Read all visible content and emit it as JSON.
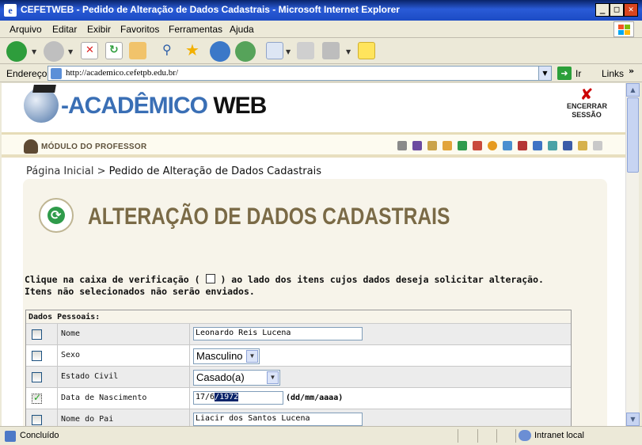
{
  "window": {
    "title": "CEFETWEB - Pedido de Alteração de Dados Cadastrais - Microsoft Internet Explorer",
    "min": "_",
    "max": "□",
    "close": "✕"
  },
  "menu": [
    "Arquivo",
    "Editar",
    "Exibir",
    "Favoritos",
    "Ferramentas",
    "Ajuda"
  ],
  "address": {
    "label": "Endereço",
    "url": "http://academico.cefetpb.edu.br/",
    "go_label": "Ir",
    "links_label": "Links"
  },
  "app": {
    "logo_part1": "-ACADÊMICO",
    "logo_part2": "WEB",
    "logout_line1": "ENCERRAR",
    "logout_line2": "SESSÃO",
    "module": "MÓDULO DO PROFESSOR"
  },
  "breadcrumb": {
    "home": "Página Inicial",
    "sep": " > ",
    "current": "Pedido de Alteração de Dados Cadastrais"
  },
  "panel": {
    "title": "ALTERAÇÃO DE DADOS CADASTRAIS",
    "instruction_a": "Clique na caixa de verificação (",
    "instruction_b": ") ao lado dos itens cujos dados deseja solicitar alteração.",
    "instruction_line2": "Itens não selecionados não serão enviados."
  },
  "form": {
    "section": "Dados Pessoais:",
    "rows": [
      {
        "label": "Nome",
        "value": "Leonardo Reis Lucena",
        "checked": false
      },
      {
        "label": "Sexo",
        "value": "Masculino",
        "checked": false
      },
      {
        "label": "Estado Civil",
        "value": "Casado(a)",
        "checked": false
      },
      {
        "label": "Data de Nascimento",
        "value_plain": "17/6",
        "value_selected": "/1972",
        "hint": "(dd/mm/aaaa)",
        "checked": true
      },
      {
        "label": "Nome do Pai",
        "value": "Liacir dos Santos Lucena",
        "checked": false
      }
    ]
  },
  "status": {
    "text": "Concluído",
    "zone": "Intranet local"
  }
}
